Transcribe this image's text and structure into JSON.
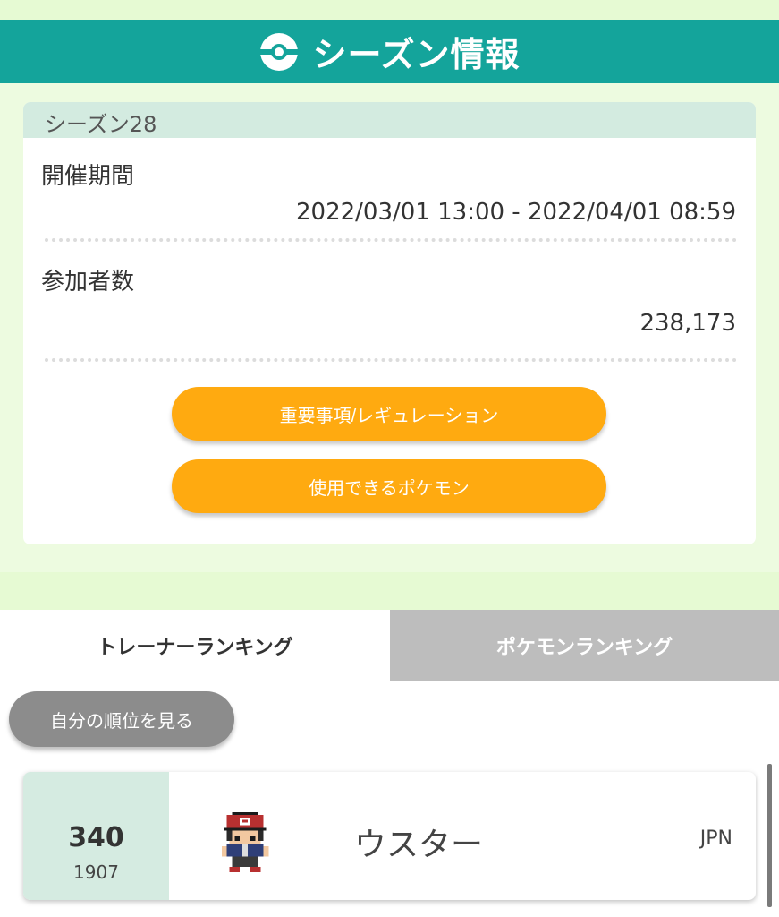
{
  "header": {
    "title": "シーズン情報",
    "icon": "pokeball-icon"
  },
  "season": {
    "label": "シーズン28",
    "period_label": "開催期間",
    "period_value": "2022/03/01 13:00 - 2022/04/01 08:59",
    "participants_label": "参加者数",
    "participants_value": "238,173",
    "buttons": {
      "regulation": "重要事項/レギュレーション",
      "pokemon": "使用できるポケモン"
    }
  },
  "tabs": {
    "trainer": "トレーナーランキング",
    "pokemon": "ポケモンランキング",
    "active": "trainer"
  },
  "my_rank_button": "自分の順位を見る",
  "ranking_entry": {
    "rank": "340",
    "rating": "1907",
    "name": "ウスター",
    "country": "JPN",
    "avatar": "trainer-sprite"
  },
  "colors": {
    "header": "#14a49b",
    "accent_orange": "#ffaa10",
    "label_bar": "#d3ebe0",
    "background_green": "#e6fad3",
    "tab_inactive": "#bdbdbd",
    "button_gray": "#8c8c8c"
  }
}
